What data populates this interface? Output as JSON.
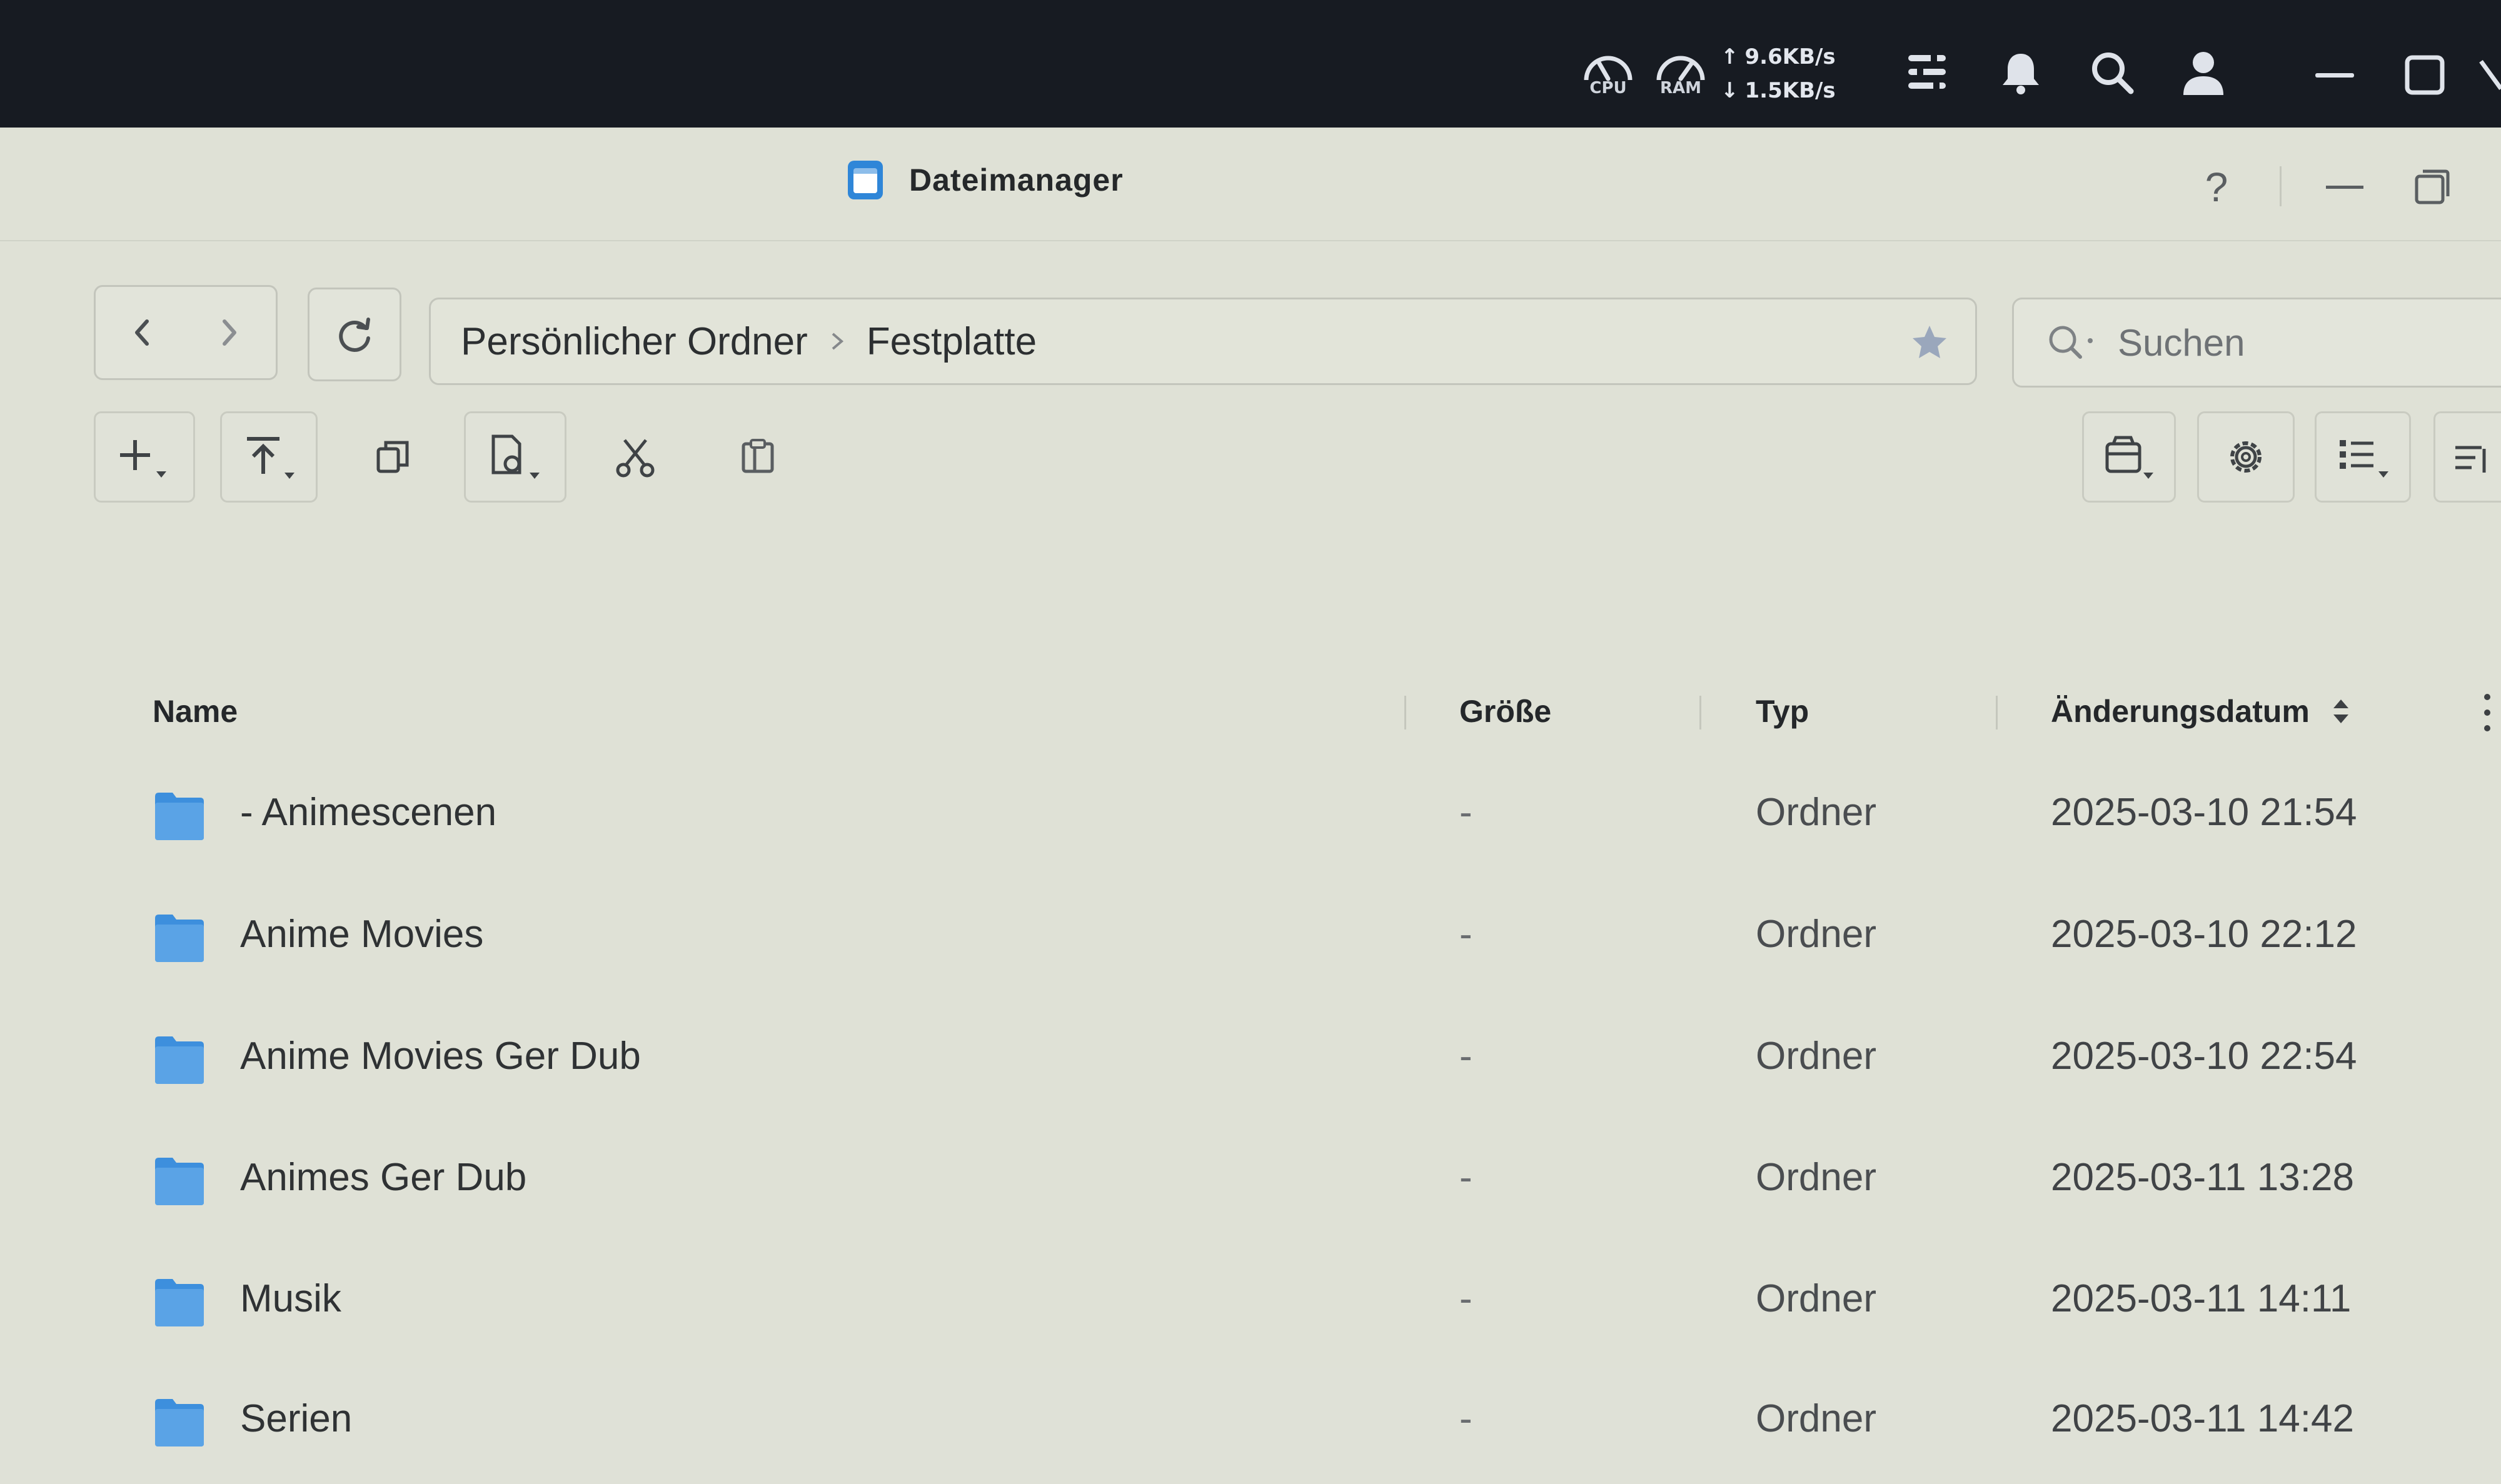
{
  "system_bar": {
    "cpu_label": "CPU",
    "ram_label": "RAM",
    "upload": "9.6KB/s",
    "download": "1.5KB/s"
  },
  "window": {
    "title": "Dateimanager",
    "help": "?"
  },
  "path": {
    "crumbs": [
      "Persönlicher Ordner",
      "Festplatte"
    ]
  },
  "search": {
    "placeholder": "Suchen"
  },
  "columns": {
    "name": "Name",
    "size": "Größe",
    "type": "Typ",
    "modified": "Änderungsdatum"
  },
  "files": [
    {
      "name": "- Animescenen",
      "size": "-",
      "type": "Ordner",
      "modified": "2025-03-10 21:54"
    },
    {
      "name": "Anime Movies",
      "size": "-",
      "type": "Ordner",
      "modified": "2025-03-10 22:12"
    },
    {
      "name": "Anime Movies Ger Dub",
      "size": "-",
      "type": "Ordner",
      "modified": "2025-03-10 22:54"
    },
    {
      "name": "Animes Ger Dub",
      "size": "-",
      "type": "Ordner",
      "modified": "2025-03-11 13:28"
    },
    {
      "name": "Musik",
      "size": "-",
      "type": "Ordner",
      "modified": "2025-03-11 14:11"
    },
    {
      "name": "Serien",
      "size": "-",
      "type": "Ordner",
      "modified": "2025-03-11 14:42"
    }
  ],
  "colors": {
    "accent": "#2f86d8",
    "folder": "#3d8fdd",
    "system_bar": "#171b22",
    "window_bg": "#dfe1d6"
  }
}
